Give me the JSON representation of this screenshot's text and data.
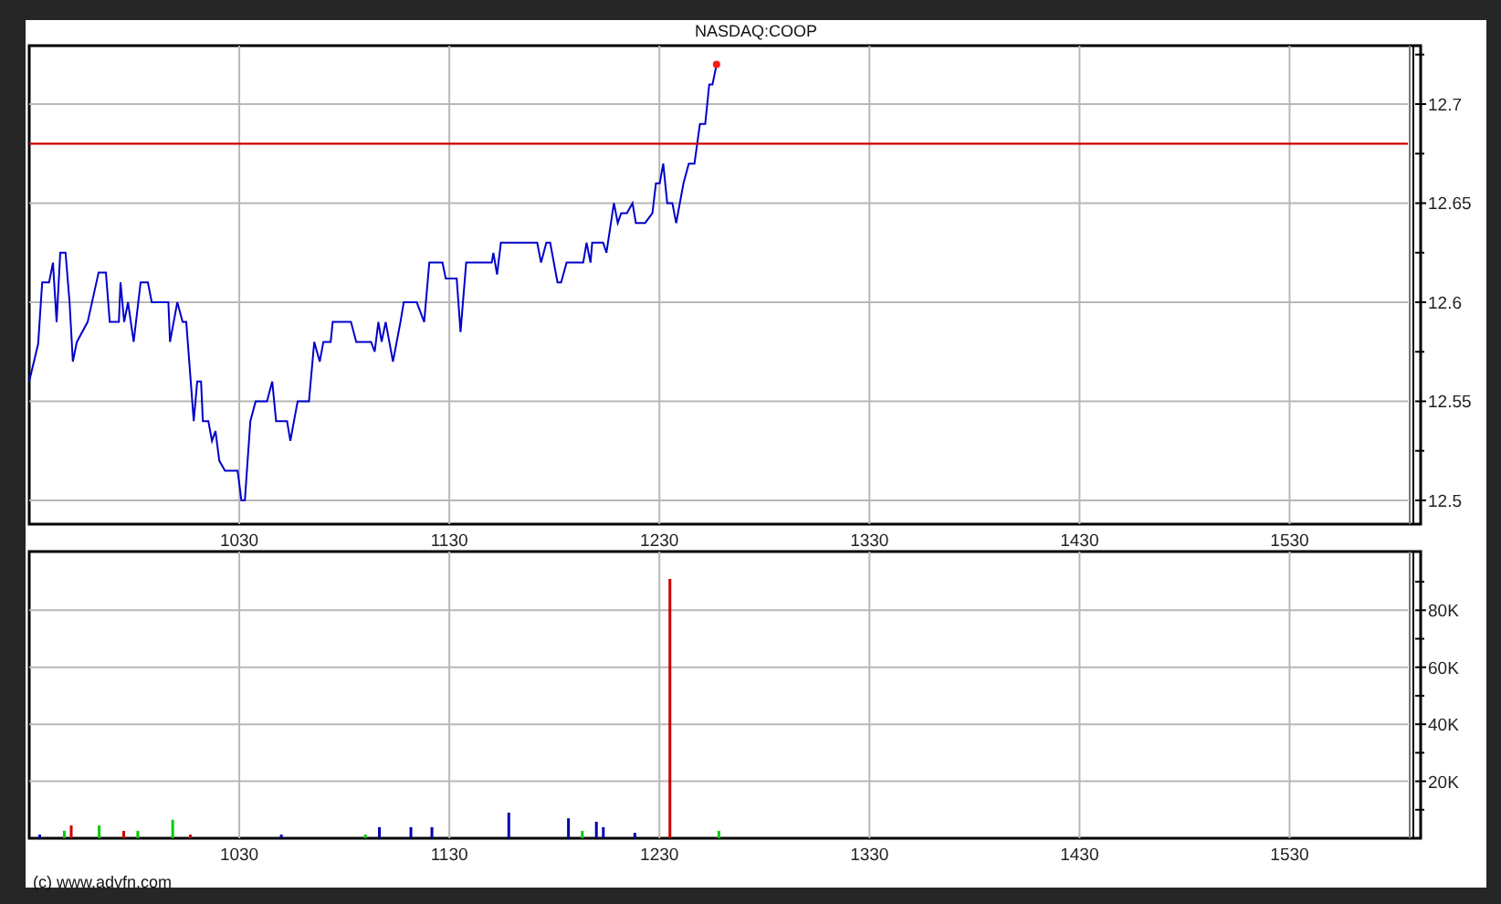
{
  "chart_panel": {
    "price_chart": {
      "chart_data": {
        "type": "line",
        "title": "NASDAQ:COOP",
        "x": [
          930,
          934.3,
          936.2,
          939.5,
          941.3,
          943,
          944.8,
          947.3,
          949.2,
          950.8,
          952.7,
          957.8,
          963,
          966.5,
          968.3,
          972.7,
          973.5,
          975.2,
          977,
          979.7,
          983,
          986.5,
          988.3,
          996.2,
          997,
          1000.5,
          1003,
          1004.8,
          1008.3,
          1010,
          1011.8,
          1012.7,
          1015.3,
          1017,
          1018.7,
          1020.5,
          1023.2,
          1029.2,
          1031,
          1032.7,
          1035.3,
          1037.8,
          1043.2,
          1045.7,
          1047.5,
          1052.7,
          1054.3,
          1057.8,
          1063.2,
          1065.7,
          1068.3,
          1070,
          1073.5,
          1074.5,
          1083.2,
          1085.7,
          1092.7,
          1094.5,
          1096.2,
          1097.8,
          1099.7,
          1103.2,
          1106.7,
          1108.3,
          1114.5,
          1118,
          1120.5,
          1126.7,
          1128.3,
          1133.5,
          1135.3,
          1138,
          1150.2,
          1151,
          1152.7,
          1154.5,
          1171.8,
          1173.7,
          1176.2,
          1178,
          1181.5,
          1183.2,
          1185.8,
          1193.7,
          1195.3,
          1197.2,
          1198,
          1203.2,
          1204.8,
          1208.3,
          1210.2,
          1211.8,
          1214.5,
          1217.2,
          1218.8,
          1223.2,
          1226.7,
          1228.3,
          1230.2,
          1231.8,
          1233.7,
          1236.2,
          1238,
          1241.5,
          1244,
          1246.7,
          1249.3,
          1251.8,
          1253.7,
          1255.3,
          1257.2
        ],
        "series": [
          {
            "color": "#0000cc",
            "values": [
              12.56,
              12.579,
              12.61,
              12.61,
              12.62,
              12.59,
              12.625,
              12.625,
              12.6,
              12.57,
              12.58,
              12.59,
              12.615,
              12.615,
              12.59,
              12.59,
              12.61,
              12.59,
              12.6,
              12.58,
              12.61,
              12.61,
              12.6,
              12.6,
              12.58,
              12.6,
              12.59,
              12.59,
              12.54,
              12.56,
              12.56,
              12.54,
              12.54,
              12.53,
              12.535,
              12.52,
              12.515,
              12.515,
              12.5,
              12.5,
              12.54,
              12.55,
              12.55,
              12.56,
              12.54,
              12.54,
              12.53,
              12.55,
              12.55,
              12.58,
              12.57,
              12.58,
              12.58,
              12.59,
              12.59,
              12.58,
              12.58,
              12.575,
              12.59,
              12.58,
              12.59,
              12.57,
              12.59,
              12.6,
              12.6,
              12.59,
              12.62,
              12.62,
              12.612,
              12.612,
              12.585,
              12.62,
              12.62,
              12.625,
              12.614,
              12.63,
              12.63,
              12.62,
              12.63,
              12.63,
              12.61,
              12.61,
              12.62,
              12.62,
              12.63,
              12.62,
              12.63,
              12.63,
              12.625,
              12.65,
              12.64,
              12.645,
              12.645,
              12.65,
              12.64,
              12.64,
              12.645,
              12.66,
              12.66,
              12.67,
              12.65,
              12.65,
              12.64,
              12.66,
              12.67,
              12.67,
              12.69,
              12.69,
              12.71,
              12.71,
              12.72
            ]
          }
        ],
        "xlim": [
          930,
          1586.3
        ],
        "ylim": [
          12.488,
          12.7295
        ],
        "xticks": [
          1030,
          1130,
          1230,
          1330,
          1430,
          1530
        ],
        "yticks": [
          12.5,
          12.55,
          12.6,
          12.65,
          12.7
        ],
        "grid": true,
        "ref_lines": [
          {
            "axis": "y",
            "value": 12.68,
            "color": "#cc0000"
          }
        ]
      }
    },
    "volume_chart": {
      "chart_data": {
        "type": "bar",
        "x": [
          935,
          946.7,
          950,
          963.3,
          975,
          981.7,
          998.3,
          1006.7,
          1050,
          1090,
          1096.7,
          1111.7,
          1121.7,
          1158.3,
          1186.7,
          1193.3,
          1200,
          1203.3,
          1218.3,
          1235,
          1258.3
        ],
        "series": [
          {
            "color": "#00cc00",
            "values": [
              null,
              2600,
              null,
              4500,
              null,
              2600,
              6500,
              null,
              null,
              1300,
              null,
              null,
              null,
              null,
              null,
              2600,
              null,
              null,
              null,
              null,
              2600
            ]
          },
          {
            "color": "#cc0000",
            "values": [
              null,
              null,
              4500,
              null,
              2600,
              null,
              null,
              1300,
              null,
              null,
              null,
              null,
              null,
              null,
              null,
              null,
              null,
              null,
              null,
              91000,
              null
            ]
          },
          {
            "color": "#0000aa",
            "values": [
              1300,
              null,
              null,
              null,
              null,
              null,
              null,
              null,
              1300,
              null,
              3900,
              3900,
              3900,
              9000,
              7000,
              null,
              5800,
              3900,
              1900,
              null,
              null
            ]
          }
        ],
        "xlim": [
          930,
          1586.3
        ],
        "ylim": [
          0,
          100600
        ],
        "grid": true,
        "xticks": [
          1030,
          1130,
          1230,
          1330,
          1430,
          1530
        ],
        "yticks": [
          {
            "value": 20000,
            "label": "20K"
          },
          {
            "value": 40000,
            "label": "40K"
          },
          {
            "value": 60000,
            "label": "60K"
          },
          {
            "value": 80000,
            "label": "80K"
          }
        ]
      }
    },
    "copyright": "(c) www.advfn.com"
  }
}
